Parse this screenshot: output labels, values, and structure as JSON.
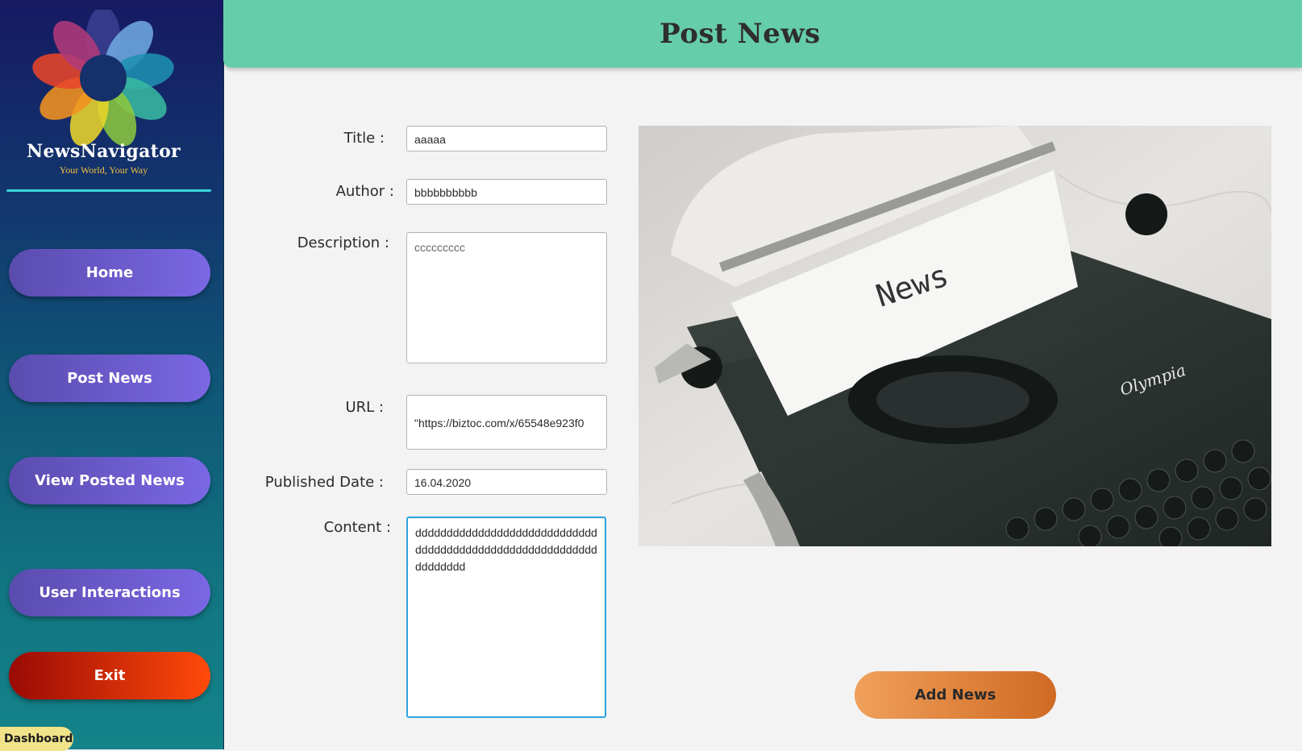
{
  "brand": {
    "name": "NewsNavigator",
    "tagline": "Your World, Your Way"
  },
  "sidebar": {
    "items": [
      {
        "label": "Home"
      },
      {
        "label": "Post News"
      },
      {
        "label": "View Posted News"
      },
      {
        "label": "User Interactions"
      },
      {
        "label": "Exit"
      }
    ],
    "badge": "Dashboard"
  },
  "header": {
    "title": "Post News"
  },
  "form": {
    "title_label": "Title :",
    "title_value": "aaaaa",
    "author_label": "Author :",
    "author_value": "bbbbbbbbbb",
    "description_label": "Description :",
    "description_value": "ccccccccc",
    "url_label": "URL :",
    "url_value": "\"https://biztoc.com/x/65548e923f0",
    "date_label": "Published Date :",
    "date_value": "16.04.2020",
    "content_label": "Content :",
    "content_value": "dddddddddddddddddddddddddddddddddddddddddddddddddddddddddddddddddd"
  },
  "image": {
    "paper_text": "News",
    "brand_text": "Olympia"
  },
  "actions": {
    "add_label": "Add News"
  },
  "colors": {
    "header_bg": "#66cdaa",
    "nav_button": "#7a67e4",
    "exit_button": "#ff4a0a",
    "add_button": "#e38a40",
    "divider": "#3ad6d8"
  }
}
